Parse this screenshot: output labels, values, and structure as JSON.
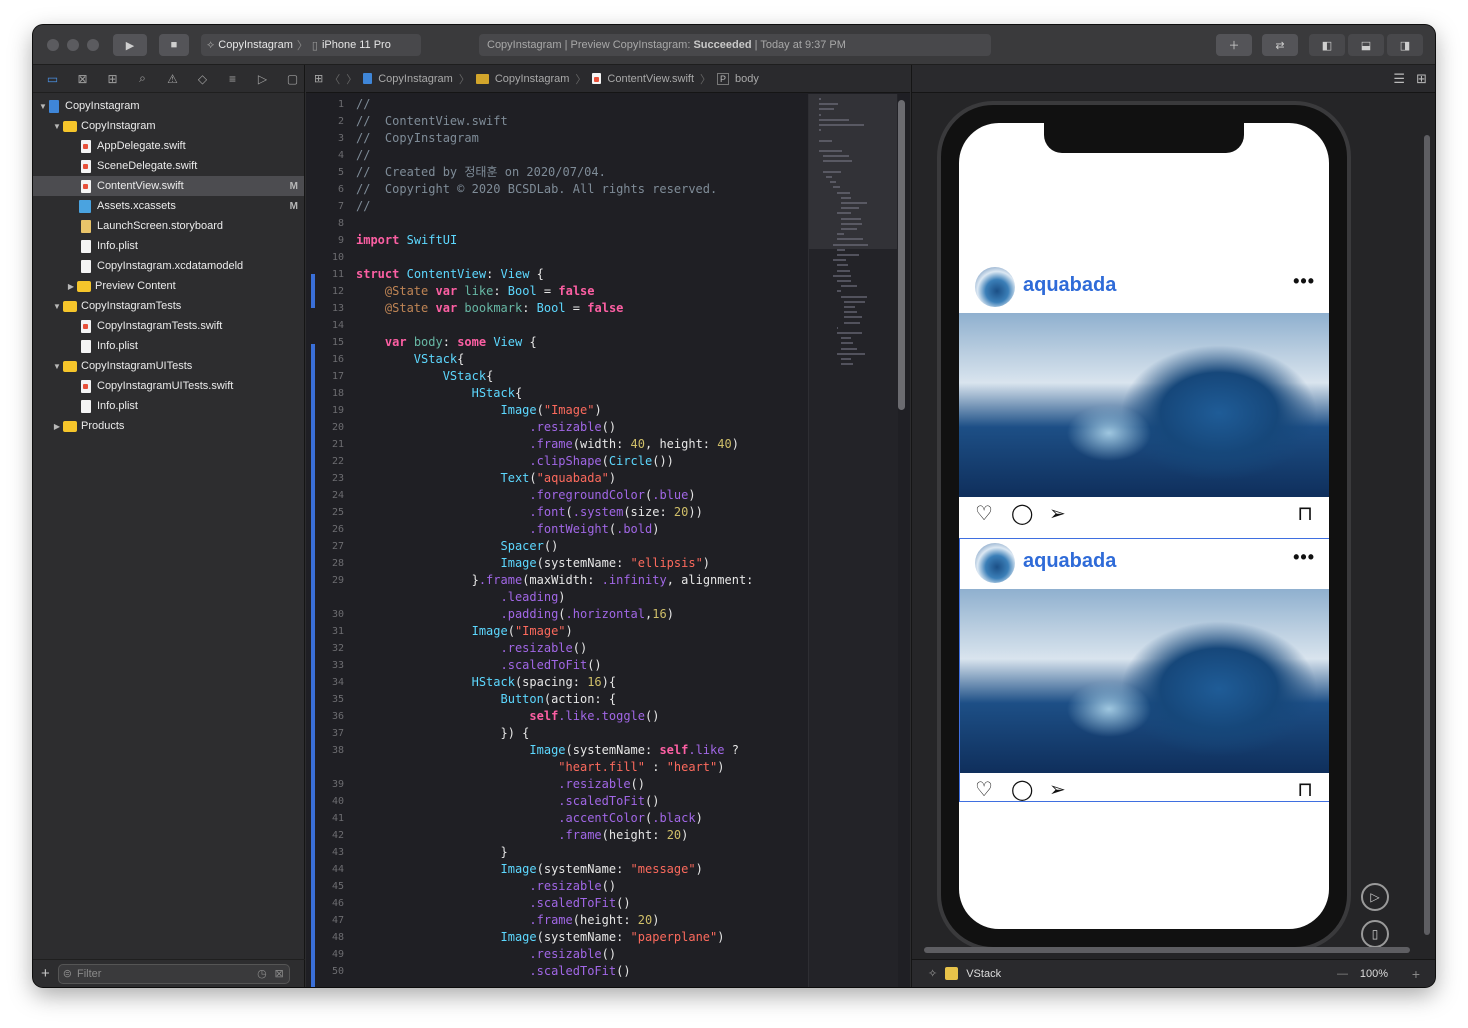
{
  "titlebar": {
    "scheme_target": "CopyInstagram",
    "device": "iPhone 11 Pro",
    "status_project": "CopyInstagram | Preview CopyInstagram:",
    "status_result": "Succeeded",
    "status_time": "| Today at 9:37 PM"
  },
  "navigator": {
    "items": [
      {
        "label": "CopyInstagram",
        "badge": ""
      },
      {
        "label": "CopyInstagram",
        "badge": ""
      },
      {
        "label": "AppDelegate.swift",
        "badge": ""
      },
      {
        "label": "SceneDelegate.swift",
        "badge": ""
      },
      {
        "label": "ContentView.swift",
        "badge": "M"
      },
      {
        "label": "Assets.xcassets",
        "badge": "M"
      },
      {
        "label": "LaunchScreen.storyboard",
        "badge": ""
      },
      {
        "label": "Info.plist",
        "badge": ""
      },
      {
        "label": "CopyInstagram.xcdatamodeld",
        "badge": ""
      },
      {
        "label": "Preview Content",
        "badge": ""
      },
      {
        "label": "CopyInstagramTests",
        "badge": ""
      },
      {
        "label": "CopyInstagramTests.swift",
        "badge": ""
      },
      {
        "label": "Info.plist",
        "badge": ""
      },
      {
        "label": "CopyInstagramUITests",
        "badge": ""
      },
      {
        "label": "CopyInstagramUITests.swift",
        "badge": ""
      },
      {
        "label": "Info.plist",
        "badge": ""
      },
      {
        "label": "Products",
        "badge": ""
      }
    ],
    "filter_placeholder": "Filter"
  },
  "jumpbar": {
    "project": "CopyInstagram",
    "group": "CopyInstagram",
    "file": "ContentView.swift",
    "symbol": "body"
  },
  "code_lines": [
    {
      "n": "1",
      "t": "//"
    },
    {
      "n": "2",
      "t": "//  ContentView.swift"
    },
    {
      "n": "3",
      "t": "//  CopyInstagram"
    },
    {
      "n": "4",
      "t": "//"
    },
    {
      "n": "5",
      "t": "//  Created by 정태훈 on 2020/07/04."
    },
    {
      "n": "6",
      "t": "//  Copyright © 2020 BCSDLab. All rights reserved."
    },
    {
      "n": "7",
      "t": "//"
    },
    {
      "n": "8",
      "t": ""
    },
    {
      "n": "9",
      "t": "import SwiftUI"
    },
    {
      "n": "10",
      "t": ""
    },
    {
      "n": "11",
      "t": "struct ContentView: View {"
    },
    {
      "n": "12",
      "t": "    @State var like: Bool = false"
    },
    {
      "n": "13",
      "t": "    @State var bookmark: Bool = false"
    },
    {
      "n": "14",
      "t": ""
    },
    {
      "n": "15",
      "t": "    var body: some View {"
    },
    {
      "n": "16",
      "t": "        VStack{"
    },
    {
      "n": "17",
      "t": "            VStack{"
    },
    {
      "n": "18",
      "t": "                HStack{"
    },
    {
      "n": "19",
      "t": "                    Image(\"Image\")"
    },
    {
      "n": "20",
      "t": "                        .resizable()"
    },
    {
      "n": "21",
      "t": "                        .frame(width: 40, height: 40)"
    },
    {
      "n": "22",
      "t": "                        .clipShape(Circle())"
    },
    {
      "n": "23",
      "t": "                    Text(\"aquabada\")"
    },
    {
      "n": "24",
      "t": "                        .foregroundColor(.blue)"
    },
    {
      "n": "25",
      "t": "                        .font(.system(size: 20))"
    },
    {
      "n": "26",
      "t": "                        .fontWeight(.bold)"
    },
    {
      "n": "27",
      "t": "                    Spacer()"
    },
    {
      "n": "28",
      "t": "                    Image(systemName: \"ellipsis\")"
    },
    {
      "n": "29",
      "t": "                }.frame(maxWidth: .infinity, alignment:"
    },
    {
      "n": "",
      "t": "                    .leading)"
    },
    {
      "n": "30",
      "t": "                    .padding(.horizontal,16)"
    },
    {
      "n": "31",
      "t": "                Image(\"Image\")"
    },
    {
      "n": "32",
      "t": "                    .resizable()"
    },
    {
      "n": "33",
      "t": "                    .scaledToFit()"
    },
    {
      "n": "34",
      "t": "                HStack(spacing: 16){"
    },
    {
      "n": "35",
      "t": "                    Button(action: {"
    },
    {
      "n": "36",
      "t": "                        self.like.toggle()"
    },
    {
      "n": "37",
      "t": "                    }) {"
    },
    {
      "n": "38",
      "t": "                        Image(systemName: self.like ?"
    },
    {
      "n": "",
      "t": "                            \"heart.fill\" : \"heart\")"
    },
    {
      "n": "39",
      "t": "                            .resizable()"
    },
    {
      "n": "40",
      "t": "                            .scaledToFit()"
    },
    {
      "n": "41",
      "t": "                            .accentColor(.black)"
    },
    {
      "n": "42",
      "t": "                            .frame(height: 20)"
    },
    {
      "n": "43",
      "t": "                    }"
    },
    {
      "n": "44",
      "t": "                    Image(systemName: \"message\")"
    },
    {
      "n": "45",
      "t": "                        .resizable()"
    },
    {
      "n": "46",
      "t": "                        .scaledToFit()"
    },
    {
      "n": "47",
      "t": "                        .frame(height: 20)"
    },
    {
      "n": "48",
      "t": "                    Image(systemName: \"paperplane\")"
    },
    {
      "n": "49",
      "t": "                        .resizable()"
    },
    {
      "n": "50",
      "t": "                        .scaledToFit()"
    }
  ],
  "preview": {
    "username": "aquabada",
    "ellipsis": "•••",
    "footer_label": "VStack",
    "zoom": "100%",
    "zoom_minus": "—",
    "zoom_plus": "+"
  },
  "icons": [
    "folder-icon",
    "play-icon",
    "stop-icon",
    "heart-icon",
    "message-icon",
    "paperplane-icon",
    "bookmark-icon"
  ]
}
